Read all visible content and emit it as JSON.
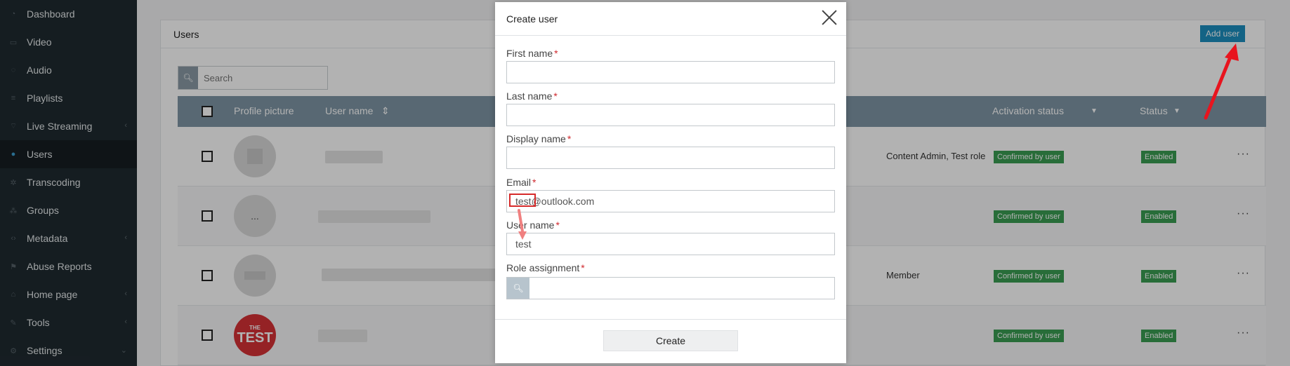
{
  "sidebar": {
    "items": [
      {
        "label": "Dashboard",
        "icon": "dashboard-icon",
        "active": false,
        "expandable": false
      },
      {
        "label": "Video",
        "icon": "video-icon",
        "active": false,
        "expandable": false
      },
      {
        "label": "Audio",
        "icon": "audio-icon",
        "active": false,
        "expandable": false
      },
      {
        "label": "Playlists",
        "icon": "playlists-icon",
        "active": false,
        "expandable": false
      },
      {
        "label": "Live Streaming",
        "icon": "live-streaming-icon",
        "active": false,
        "expandable": true
      },
      {
        "label": "Users",
        "icon": "user-icon",
        "active": true,
        "expandable": false
      },
      {
        "label": "Transcoding",
        "icon": "gear-icon",
        "active": false,
        "expandable": false
      },
      {
        "label": "Groups",
        "icon": "groups-icon",
        "active": false,
        "expandable": false
      },
      {
        "label": "Metadata",
        "icon": "metadata-icon",
        "active": false,
        "expandable": true
      },
      {
        "label": "Abuse Reports",
        "icon": "flag-icon",
        "active": false,
        "expandable": false
      },
      {
        "label": "Home page",
        "icon": "home-icon",
        "active": false,
        "expandable": true
      },
      {
        "label": "Tools",
        "icon": "wrench-icon",
        "active": false,
        "expandable": true
      },
      {
        "label": "Settings",
        "icon": "settings-icon",
        "active": false,
        "expandable": true
      }
    ]
  },
  "users_panel": {
    "title": "Users",
    "add_user_label": "Add user",
    "search_placeholder": "Search",
    "columns": {
      "profile_picture": "Profile picture",
      "user_name": "User name",
      "activation_status": "Activation status",
      "status": "Status"
    },
    "rows": [
      {
        "roles": "Content Admin, Test role",
        "activation": "Confirmed by user",
        "status": "Enabled",
        "avatar": "placeholder"
      },
      {
        "roles": "",
        "activation": "Confirmed by user",
        "status": "Enabled",
        "avatar": "ellipsis"
      },
      {
        "roles": "Member",
        "activation": "Confirmed by user",
        "status": "Enabled",
        "avatar": "placeholder"
      },
      {
        "roles": "",
        "activation": "Confirmed by user",
        "status": "Enabled",
        "avatar": "test-logo"
      }
    ],
    "avatar_logo_text_small": "THE",
    "avatar_logo_text_large": "TEST",
    "avatar_ellipsis": "...",
    "more_actions": "···"
  },
  "modal": {
    "title": "Create user",
    "fields": {
      "first_name": {
        "label": "First name",
        "value": ""
      },
      "last_name": {
        "label": "Last name",
        "value": ""
      },
      "display_name": {
        "label": "Display name",
        "value": ""
      },
      "email": {
        "label": "Email",
        "value": "test@outlook.com"
      },
      "user_name": {
        "label": "User name",
        "value": "test"
      },
      "role_assignment": {
        "label": "Role assignment",
        "value": ""
      }
    },
    "required_marker": "*",
    "create_label": "Create"
  },
  "colors": {
    "accent": "#1c8fbf",
    "badge_green": "#3a9d52",
    "required_red": "#d0292e",
    "annotation_red": "#e8141e"
  }
}
